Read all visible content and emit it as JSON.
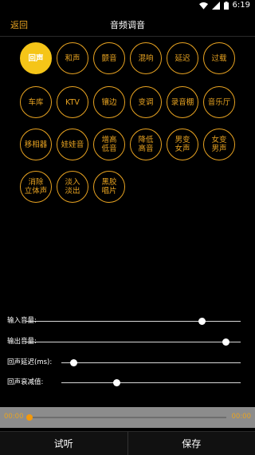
{
  "status": {
    "time": "6:19"
  },
  "header": {
    "back_label": "返回",
    "title": "音频调音"
  },
  "effects": [
    {
      "label": "回声",
      "active": true
    },
    {
      "label": "和声"
    },
    {
      "label": "颤音"
    },
    {
      "label": "混响"
    },
    {
      "label": "延迟"
    },
    {
      "label": "过载"
    },
    {
      "label": "车库"
    },
    {
      "label": "KTV"
    },
    {
      "label": "镶边"
    },
    {
      "label": "变调"
    },
    {
      "label": "录音棚"
    },
    {
      "label": "音乐厅"
    },
    {
      "label": "移相器"
    },
    {
      "label": "娃娃音"
    },
    {
      "label": "增高\n低音"
    },
    {
      "label": "降低\n高音"
    },
    {
      "label": "男变\n女声"
    },
    {
      "label": "女变\n男声"
    },
    {
      "label": "消除\n立体声"
    },
    {
      "label": "淡入\n淡出"
    },
    {
      "label": "黑胶\n唱片"
    }
  ],
  "sliders": [
    {
      "label": "输入音量:",
      "value": 0.82
    },
    {
      "label": "输出音量:",
      "value": 0.93
    },
    {
      "label": "回声延迟(ms):",
      "value": 0.07
    },
    {
      "label": "回声衰减值:",
      "value": 0.31
    }
  ],
  "player": {
    "current": "00:00",
    "total": "00:00",
    "progress": 0
  },
  "footer": {
    "preview_label": "试听",
    "save_label": "保存"
  },
  "colors": {
    "accent": "#e8a321",
    "active_fill": "#f5c518"
  }
}
